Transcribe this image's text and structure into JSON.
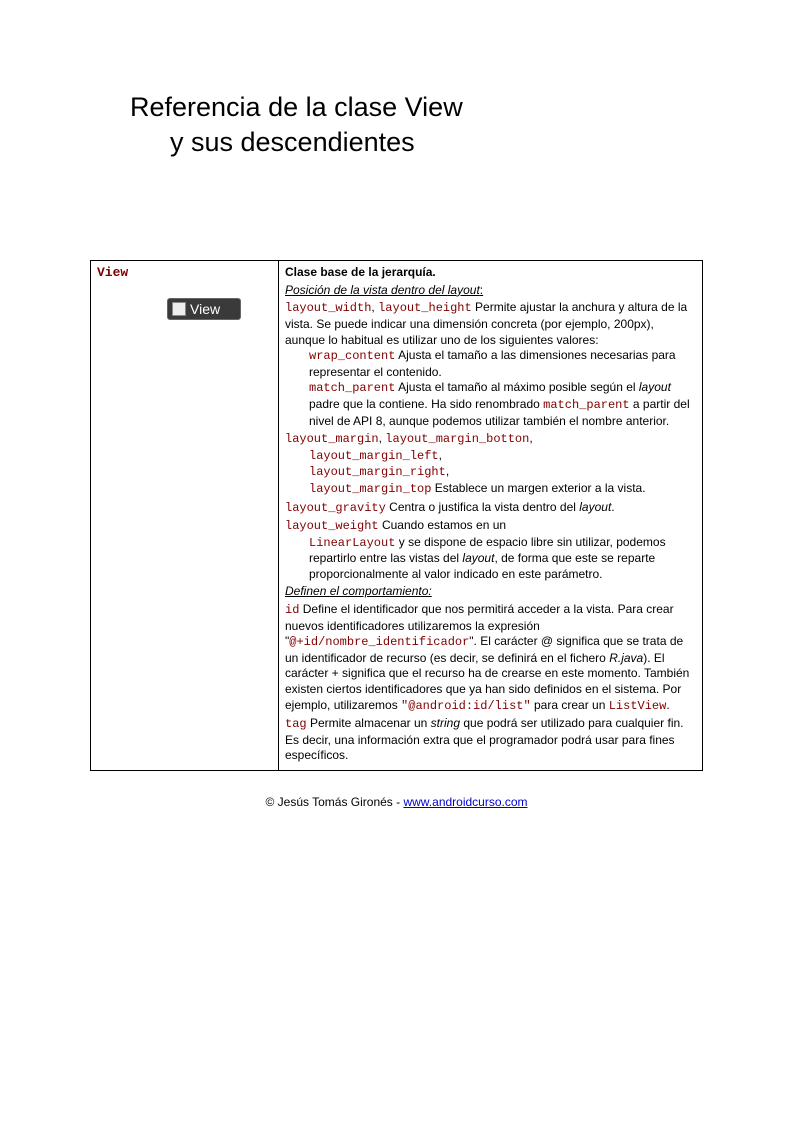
{
  "title_line1": "Referencia de la clase View",
  "title_line2": "y sus descendientes",
  "left": {
    "class_name": "View",
    "badge_label": "View"
  },
  "right": {
    "heading": "Clase base de la jerarquía.",
    "section_position_prefix": "Posición de la vista dentro del ",
    "section_position_layout": "layout",
    "section_position_colon": ":",
    "attrs": {
      "layout_wh": {
        "c1": "layout_width",
        "sep": ", ",
        "c2": "layout_height",
        "text": " Permite ajustar la anchura y altura de la vista. Se puede indicar una dimensión concreta (por ejemplo, 200px), aunque lo habitual es utilizar uno de los siguientes valores:"
      },
      "wrap_content": {
        "c": "wrap_content",
        "text": " Ajusta el tamaño a las dimensiones necesarias para representar el contenido."
      },
      "match_parent": {
        "c": "match_parent",
        "t1": " Ajusta el tamaño al máximo posible según el ",
        "it1": "layout",
        "t2": " padre que la contiene. Ha sido renombrado ",
        "c2": "match_parent",
        "t3": " a partir del nivel de API 8, aunque podemos utilizar también el nombre anterior."
      },
      "layout_margin": {
        "c1": "layout_margin",
        "sep": ", ",
        "c2": "layout_margin_botton",
        "c3": "layout_margin_left",
        "c4": "layout_margin_right",
        "c5": "layout_margin_top",
        "text": " Establece un margen exterior a la vista."
      },
      "layout_gravity": {
        "c": "layout_gravity",
        "t1": " Centra o justifica la vista dentro del ",
        "it": "layout",
        "t2": "."
      },
      "layout_weight": {
        "c": "layout_weight",
        "t1": " Cuando estamos en un ",
        "c2": "LinearLayout",
        "t2": " y se dispone de espacio libre sin utilizar, podemos repartirlo entre las vistas del ",
        "it": "layout",
        "t3": ", de forma que este se reparte proporcionalmente al valor indicado en este parámetro."
      }
    },
    "section_behavior": "Definen el comportamiento:",
    "behavior": {
      "id": {
        "c": "id",
        "t1": " Define el identificador que nos permitirá acceder a la vista. Para crear nuevos identificadores utilizaremos la expresión \"",
        "c2": "@+id/nombre_identificador",
        "t2": "\". El carácter @ significa que se trata de un identificador de recurso (es decir, se definirá en el fichero ",
        "it": "R.java",
        "t3": "). El carácter + significa que el recurso ha de crearse en este momento. También existen ciertos identificadores que ya han sido definidos en el sistema. Por ejemplo, utilizaremos ",
        "c3": "\"@android:id/list\"",
        "t4": " para crear un ",
        "c4": "ListView",
        "t5": "."
      },
      "tag": {
        "c": "tag",
        "t1": " Permite almacenar un ",
        "it": "string",
        "t2": " que podrá ser utilizado para cualquier fin. Es decir, una información extra que el programador podrá usar para fines específicos."
      }
    }
  },
  "footer": {
    "copyright": "© Jesús Tomás Gironés -  ",
    "link_text": "www.androidcurso.com"
  }
}
